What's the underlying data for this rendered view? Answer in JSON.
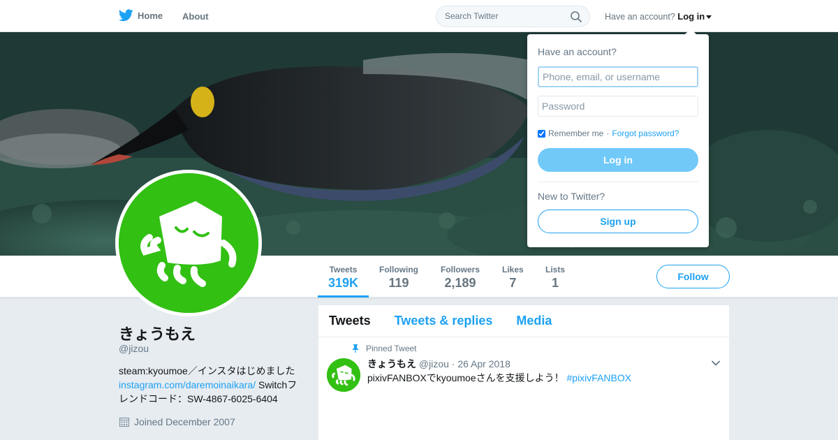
{
  "nav": {
    "home_label": "Home",
    "about_label": "About",
    "search_placeholder": "Search Twitter",
    "account_prompt": "Have an account?",
    "login_label": "Log in"
  },
  "profile": {
    "name": "きょうもえ",
    "handle": "@jizou",
    "bio_line1": "steam:kyoumoe／インスタはじめました",
    "bio_link": "instagram.com/daremoinaikara/",
    "bio_line2": " Switchフレンドコード：SW-4867-6025-6404",
    "joined": "Joined December 2007"
  },
  "stats": [
    {
      "label": "Tweets",
      "value": "319K"
    },
    {
      "label": "Following",
      "value": "119"
    },
    {
      "label": "Followers",
      "value": "2,189"
    },
    {
      "label": "Likes",
      "value": "7"
    },
    {
      "label": "Lists",
      "value": "1"
    }
  ],
  "follow_label": "Follow",
  "tabs": [
    {
      "label": "Tweets"
    },
    {
      "label": "Tweets & replies"
    },
    {
      "label": "Media"
    }
  ],
  "tweet": {
    "pinned_label": "Pinned Tweet",
    "author_name": "きょうもえ",
    "author_handle": "@jizou",
    "date": "· 26 Apr 2018",
    "text": "pixivFANBOXでkyoumoeさんを支援しよう！",
    "hashtag": "#pixivFANBOX"
  },
  "login_dropdown": {
    "title": "Have an account?",
    "username_placeholder": "Phone, email, or username",
    "password_placeholder": "Password",
    "remember_label": "Remember me",
    "separator": " · ",
    "forgot_label": "Forgot password?",
    "login_button": "Log in",
    "new_prompt": "New to Twitter?",
    "signup_button": "Sign up"
  },
  "colors": {
    "accent": "#1da1f2",
    "avatar_green": "#32c013"
  }
}
